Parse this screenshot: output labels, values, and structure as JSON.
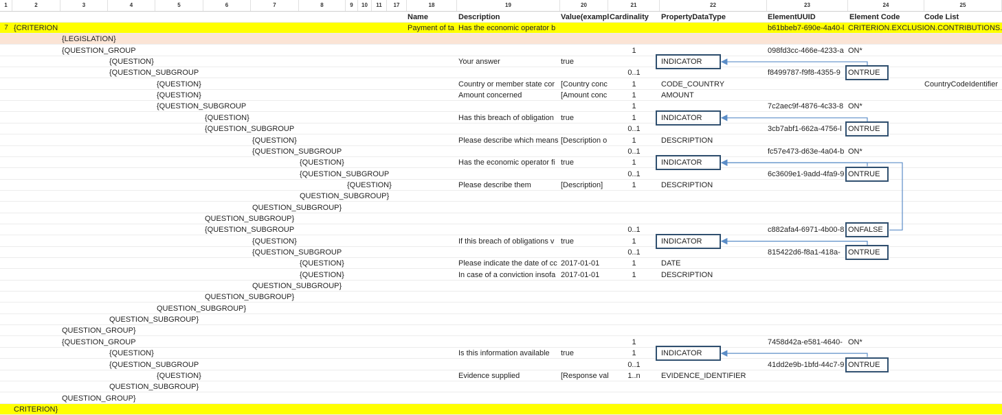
{
  "colors": {
    "highlight": "#ffff00",
    "legislation_row": "#fbe4d5",
    "arrow": "#5b8dc7",
    "box_border": "#2f4f6f"
  },
  "column_headers": [
    "1",
    "2",
    "3",
    "4",
    "5",
    "6",
    "7",
    "8",
    "9",
    "10",
    "11",
    "17",
    "18",
    "19",
    "20",
    "21",
    "22",
    "23",
    "24",
    "25"
  ],
  "field_headers": {
    "name": "Name",
    "description": "Description",
    "value": "Value(exampl",
    "cardinality": "Cardinality",
    "property_data_type": "PropertyDataType",
    "element_uuid": "ElementUUID",
    "element_code": "Element Code",
    "code_list": "Code List"
  },
  "rows": [
    {
      "num": "7",
      "tag": "{CRITERION",
      "level": 0,
      "name": "Payment of ta",
      "description": "Has the economic operator b",
      "value": "",
      "card": "",
      "ptype": "",
      "uuid": "b61bbeb7-690e-4a40-l",
      "code": "CRITERION.EXCLUSION.CONTRIBUTIONS.PAY",
      "codelist": ""
    },
    {
      "num": "",
      "tag": "{LEGISLATION}",
      "level": 1,
      "name": "",
      "description": "",
      "value": "",
      "card": "",
      "ptype": "",
      "uuid": "",
      "code": "",
      "codelist": ""
    },
    {
      "num": "",
      "tag": "{QUESTION_GROUP",
      "level": 1,
      "name": "",
      "description": "",
      "value": "",
      "card": "1",
      "ptype": "",
      "uuid": "098fd3cc-466e-4233-a",
      "code": "ON*",
      "codelist": ""
    },
    {
      "num": "",
      "tag": "{QUESTION}",
      "level": 2,
      "name": "",
      "description": "Your answer",
      "value": "true",
      "card": "",
      "ptype": "INDICATOR",
      "uuid": "",
      "code": "",
      "codelist": ""
    },
    {
      "num": "",
      "tag": "{QUESTION_SUBGROUP",
      "level": 2,
      "name": "",
      "description": "",
      "value": "",
      "card": "0..1",
      "ptype": "",
      "uuid": "f8499787-f9f8-4355-9",
      "code": "ONTRUE",
      "codelist": ""
    },
    {
      "num": "",
      "tag": "{QUESTION}",
      "level": 3,
      "name": "",
      "description": "Country or member state cor",
      "value": "[Country conc",
      "card": "1",
      "ptype": "CODE_COUNTRY",
      "uuid": "",
      "code": "",
      "codelist": "CountryCodeIdentifier"
    },
    {
      "num": "",
      "tag": "{QUESTION}",
      "level": 3,
      "name": "",
      "description": "Amount concerned",
      "value": "[Amount conc",
      "card": "1",
      "ptype": "AMOUNT",
      "uuid": "",
      "code": "",
      "codelist": ""
    },
    {
      "num": "",
      "tag": "{QUESTION_SUBGROUP",
      "level": 3,
      "name": "",
      "description": "",
      "value": "",
      "card": "1",
      "ptype": "",
      "uuid": "7c2aec9f-4876-4c33-8",
      "code": "ON*",
      "codelist": ""
    },
    {
      "num": "",
      "tag": "{QUESTION}",
      "level": 4,
      "name": "",
      "description": "Has this breach of obligation",
      "value": "true",
      "card": "1",
      "ptype": "INDICATOR",
      "uuid": "",
      "code": "",
      "codelist": ""
    },
    {
      "num": "",
      "tag": "{QUESTION_SUBGROUP",
      "level": 4,
      "name": "",
      "description": "",
      "value": "",
      "card": "0..1",
      "ptype": "",
      "uuid": "3cb7abf1-662a-4756-l",
      "code": "ONTRUE",
      "codelist": ""
    },
    {
      "num": "",
      "tag": "{QUESTION}",
      "level": 5,
      "name": "",
      "description": "Please describe which means",
      "value": "[Description o",
      "card": "1",
      "ptype": "DESCRIPTION",
      "uuid": "",
      "code": "",
      "codelist": ""
    },
    {
      "num": "",
      "tag": "{QUESTION_SUBGROUP",
      "level": 5,
      "name": "",
      "description": "",
      "value": "",
      "card": "0..1",
      "ptype": "",
      "uuid": "fc57e473-d63e-4a04-b",
      "code": "ON*",
      "codelist": ""
    },
    {
      "num": "",
      "tag": "{QUESTION}",
      "level": 6,
      "name": "",
      "description": "Has the economic operator fi",
      "value": "true",
      "card": "1",
      "ptype": "INDICATOR",
      "uuid": "",
      "code": "",
      "codelist": ""
    },
    {
      "num": "",
      "tag": "{QUESTION_SUBGROUP",
      "level": 6,
      "name": "",
      "description": "",
      "value": "",
      "card": "0..1",
      "ptype": "",
      "uuid": "6c3609e1-9add-4fa9-9",
      "code": "ONTRUE",
      "codelist": ""
    },
    {
      "num": "",
      "tag": "{QUESTION}",
      "level": 7,
      "name": "",
      "description": "Please describe them",
      "value": "[Description]",
      "card": "1",
      "ptype": "DESCRIPTION",
      "uuid": "",
      "code": "",
      "codelist": ""
    },
    {
      "num": "",
      "tag": "QUESTION_SUBGROUP}",
      "level": 6,
      "name": "",
      "description": "",
      "value": "",
      "card": "",
      "ptype": "",
      "uuid": "",
      "code": "",
      "codelist": ""
    },
    {
      "num": "",
      "tag": "QUESTION_SUBGROUP}",
      "level": 5,
      "name": "",
      "description": "",
      "value": "",
      "card": "",
      "ptype": "",
      "uuid": "",
      "code": "",
      "codelist": ""
    },
    {
      "num": "",
      "tag": "QUESTION_SUBGROUP}",
      "level": 4,
      "name": "",
      "description": "",
      "value": "",
      "card": "",
      "ptype": "",
      "uuid": "",
      "code": "",
      "codelist": ""
    },
    {
      "num": "",
      "tag": "{QUESTION_SUBGROUP",
      "level": 4,
      "name": "",
      "description": "",
      "value": "",
      "card": "0..1",
      "ptype": "",
      "uuid": "c882afa4-6971-4b00-8",
      "code": "ONFALSE",
      "codelist": ""
    },
    {
      "num": "",
      "tag": "{QUESTION}",
      "level": 5,
      "name": "",
      "description": "If this breach of obligations v",
      "value": "true",
      "card": "1",
      "ptype": "INDICATOR",
      "uuid": "",
      "code": "",
      "codelist": ""
    },
    {
      "num": "",
      "tag": "{QUESTION_SUBGROUP",
      "level": 5,
      "name": "",
      "description": "",
      "value": "",
      "card": "0..1",
      "ptype": "",
      "uuid": "815422d6-f8a1-418a-",
      "code": "ONTRUE",
      "codelist": ""
    },
    {
      "num": "",
      "tag": "{QUESTION}",
      "level": 6,
      "name": "",
      "description": "Please indicate the date of cc",
      "value": "2017-01-01",
      "card": "1",
      "ptype": "DATE",
      "uuid": "",
      "code": "",
      "codelist": ""
    },
    {
      "num": "",
      "tag": "{QUESTION}",
      "level": 6,
      "name": "",
      "description": "In case of a conviction insofa",
      "value": "2017-01-01",
      "card": "1",
      "ptype": "DESCRIPTION",
      "uuid": "",
      "code": "",
      "codelist": ""
    },
    {
      "num": "",
      "tag": "QUESTION_SUBGROUP}",
      "level": 5,
      "name": "",
      "description": "",
      "value": "",
      "card": "",
      "ptype": "",
      "uuid": "",
      "code": "",
      "codelist": ""
    },
    {
      "num": "",
      "tag": "QUESTION_SUBGROUP}",
      "level": 4,
      "name": "",
      "description": "",
      "value": "",
      "card": "",
      "ptype": "",
      "uuid": "",
      "code": "",
      "codelist": ""
    },
    {
      "num": "",
      "tag": "QUESTION_SUBGROUP}",
      "level": 3,
      "name": "",
      "description": "",
      "value": "",
      "card": "",
      "ptype": "",
      "uuid": "",
      "code": "",
      "codelist": ""
    },
    {
      "num": "",
      "tag": "QUESTION_SUBGROUP}",
      "level": 2,
      "name": "",
      "description": "",
      "value": "",
      "card": "",
      "ptype": "",
      "uuid": "",
      "code": "",
      "codelist": ""
    },
    {
      "num": "",
      "tag": "QUESTION_GROUP}",
      "level": 1,
      "name": "",
      "description": "",
      "value": "",
      "card": "",
      "ptype": "",
      "uuid": "",
      "code": "",
      "codelist": ""
    },
    {
      "num": "",
      "tag": "{QUESTION_GROUP",
      "level": 1,
      "name": "",
      "description": "",
      "value": "",
      "card": "1",
      "ptype": "",
      "uuid": "7458d42a-e581-4640-",
      "code": "ON*",
      "codelist": ""
    },
    {
      "num": "",
      "tag": "{QUESTION}",
      "level": 2,
      "name": "",
      "description": "Is this information available",
      "value": "true",
      "card": "1",
      "ptype": "INDICATOR",
      "uuid": "",
      "code": "",
      "codelist": ""
    },
    {
      "num": "",
      "tag": "{QUESTION_SUBGROUP",
      "level": 2,
      "name": "",
      "description": "",
      "value": "",
      "card": "0..1",
      "ptype": "",
      "uuid": "41dd2e9b-1bfd-44c7-9",
      "code": "ONTRUE",
      "codelist": ""
    },
    {
      "num": "",
      "tag": "{QUESTION}",
      "level": 3,
      "name": "",
      "description": "Evidence supplied",
      "value": "[Response valu",
      "card": "1..n",
      "ptype": "EVIDENCE_IDENTIFIER",
      "uuid": "",
      "code": "",
      "codelist": ""
    },
    {
      "num": "",
      "tag": "QUESTION_SUBGROUP}",
      "level": 2,
      "name": "",
      "description": "",
      "value": "",
      "card": "",
      "ptype": "",
      "uuid": "",
      "code": "",
      "codelist": ""
    },
    {
      "num": "",
      "tag": "QUESTION_GROUP}",
      "level": 1,
      "name": "",
      "description": "",
      "value": "",
      "card": "",
      "ptype": "",
      "uuid": "",
      "code": "",
      "codelist": ""
    },
    {
      "num": "",
      "tag": "CRITERION}",
      "level": 0,
      "name": "",
      "description": "",
      "value": "",
      "card": "",
      "ptype": "",
      "uuid": "",
      "code": "",
      "codelist": ""
    }
  ],
  "boxed_type_rows": [
    3,
    8,
    12,
    19,
    29
  ],
  "boxed_code_rows": [
    4,
    9,
    13,
    18,
    20,
    30
  ],
  "highlight_rows": [
    0,
    34
  ],
  "legislation_rows": [
    1
  ]
}
